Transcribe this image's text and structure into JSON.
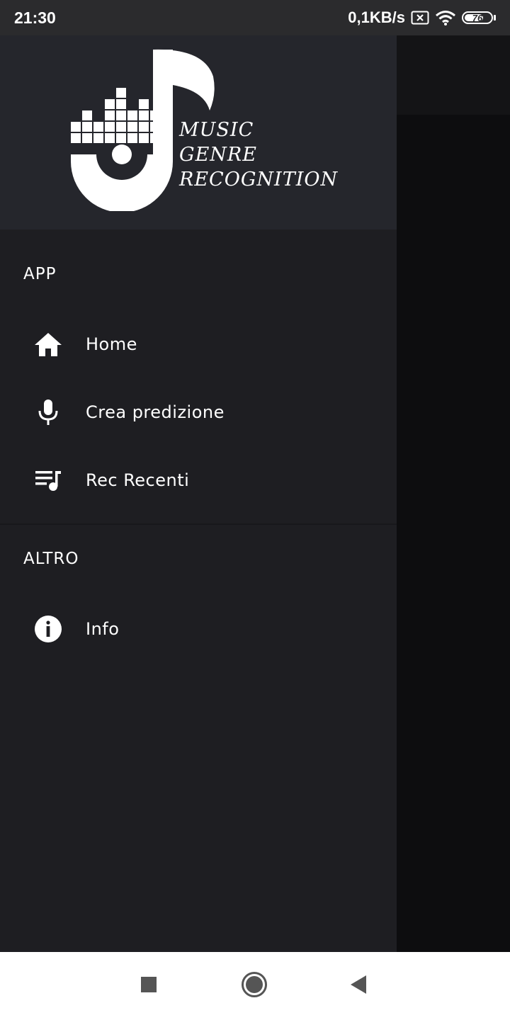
{
  "status_bar": {
    "time": "21:30",
    "network_speed": "0,1KB/s",
    "battery_level": "76",
    "battery_fraction": 0.76,
    "icons": [
      "sim-blocked-icon",
      "wifi-icon",
      "battery-icon"
    ]
  },
  "drawer": {
    "logo": {
      "line1": "MUSIC",
      "line2": "GENRE",
      "line3": "RECOGNITION"
    },
    "sections": [
      {
        "label": "APP",
        "items": [
          {
            "label": "Home",
            "icon": "home-icon"
          },
          {
            "label": "Crea predizione",
            "icon": "microphone-icon"
          },
          {
            "label": "Rec Recenti",
            "icon": "playlist-music-icon"
          }
        ]
      },
      {
        "label": "ALTRO",
        "items": [
          {
            "label": "Info",
            "icon": "info-icon"
          }
        ]
      }
    ]
  },
  "nav_bar": {
    "icons": [
      "recents-square-icon",
      "home-circle-icon",
      "back-triangle-icon"
    ]
  },
  "colors": {
    "drawer_bg": "#1e1e22",
    "header_bg": "#25262c",
    "text": "#ffffff",
    "status_bar_bg": "#2b2b2d"
  }
}
